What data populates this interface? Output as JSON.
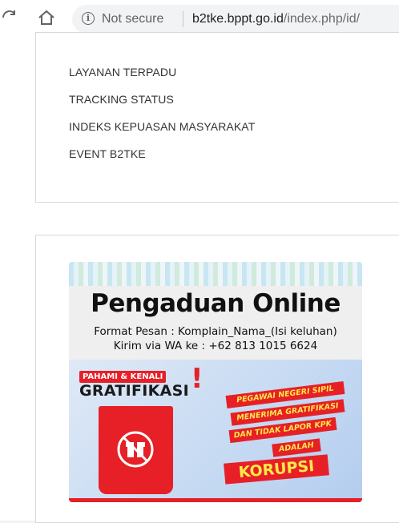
{
  "browser": {
    "reload_icon": "reload-icon",
    "home_icon": "home-icon",
    "info_icon": "info-icon",
    "security_label": "Not secure",
    "url_host": "b2tke.bppt.go.id",
    "url_path": "/index.php/id/"
  },
  "nav_links": [
    "LAYANAN TERPADU",
    "TRACKING STATUS",
    "INDEKS KEPUASAN MASYARAKAT",
    "EVENT B2TKE"
  ],
  "banner": {
    "title": "Pengaduan Online",
    "format_line": "Format Pesan : Komplain_Nama_(Isi keluhan)",
    "wa_line": "Kirim via WA ke : +62 813 1015 6624",
    "pahami": "PAHAMI & KENALI",
    "gratifikasi": "GRATIFIKASI",
    "ribbon_1": "PEGAWAI NEGERI SIPIL",
    "ribbon_2": "MENERIMA GRATIFIKASI",
    "ribbon_3": "DAN TIDAK LAPOR KPK",
    "ribbon_4": "ADALAH",
    "korupsi": "KORUPSI",
    "gift_icon": "no-gift-icon",
    "accent_color": "#e62026"
  }
}
